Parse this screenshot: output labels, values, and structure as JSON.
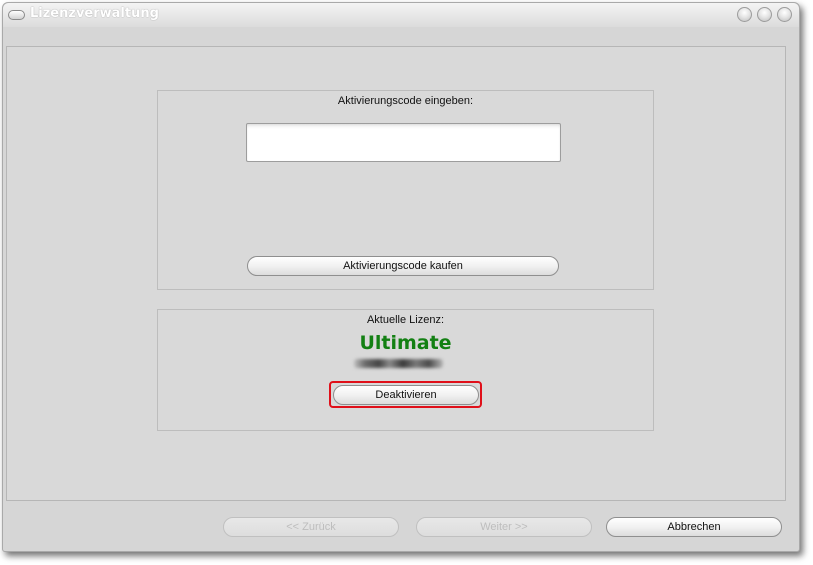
{
  "window": {
    "title": "Lizenzverwaltung",
    "controls": [
      "minimize-icon",
      "maximize-icon",
      "close-icon"
    ]
  },
  "activation": {
    "label": "Aktivierungscode eingeben:",
    "input_value": "",
    "buy_button_label": "Aktivierungscode kaufen"
  },
  "license": {
    "label": "Aktuelle Lizenz:",
    "edition": "Ultimate",
    "edition_color": "#138013",
    "deactivate_button_label": "Deaktivieren",
    "highlight_color": "#e0101a"
  },
  "footer": {
    "back_label": "<< Zurück",
    "next_label": "Weiter >>",
    "cancel_label": "Abbrechen"
  }
}
